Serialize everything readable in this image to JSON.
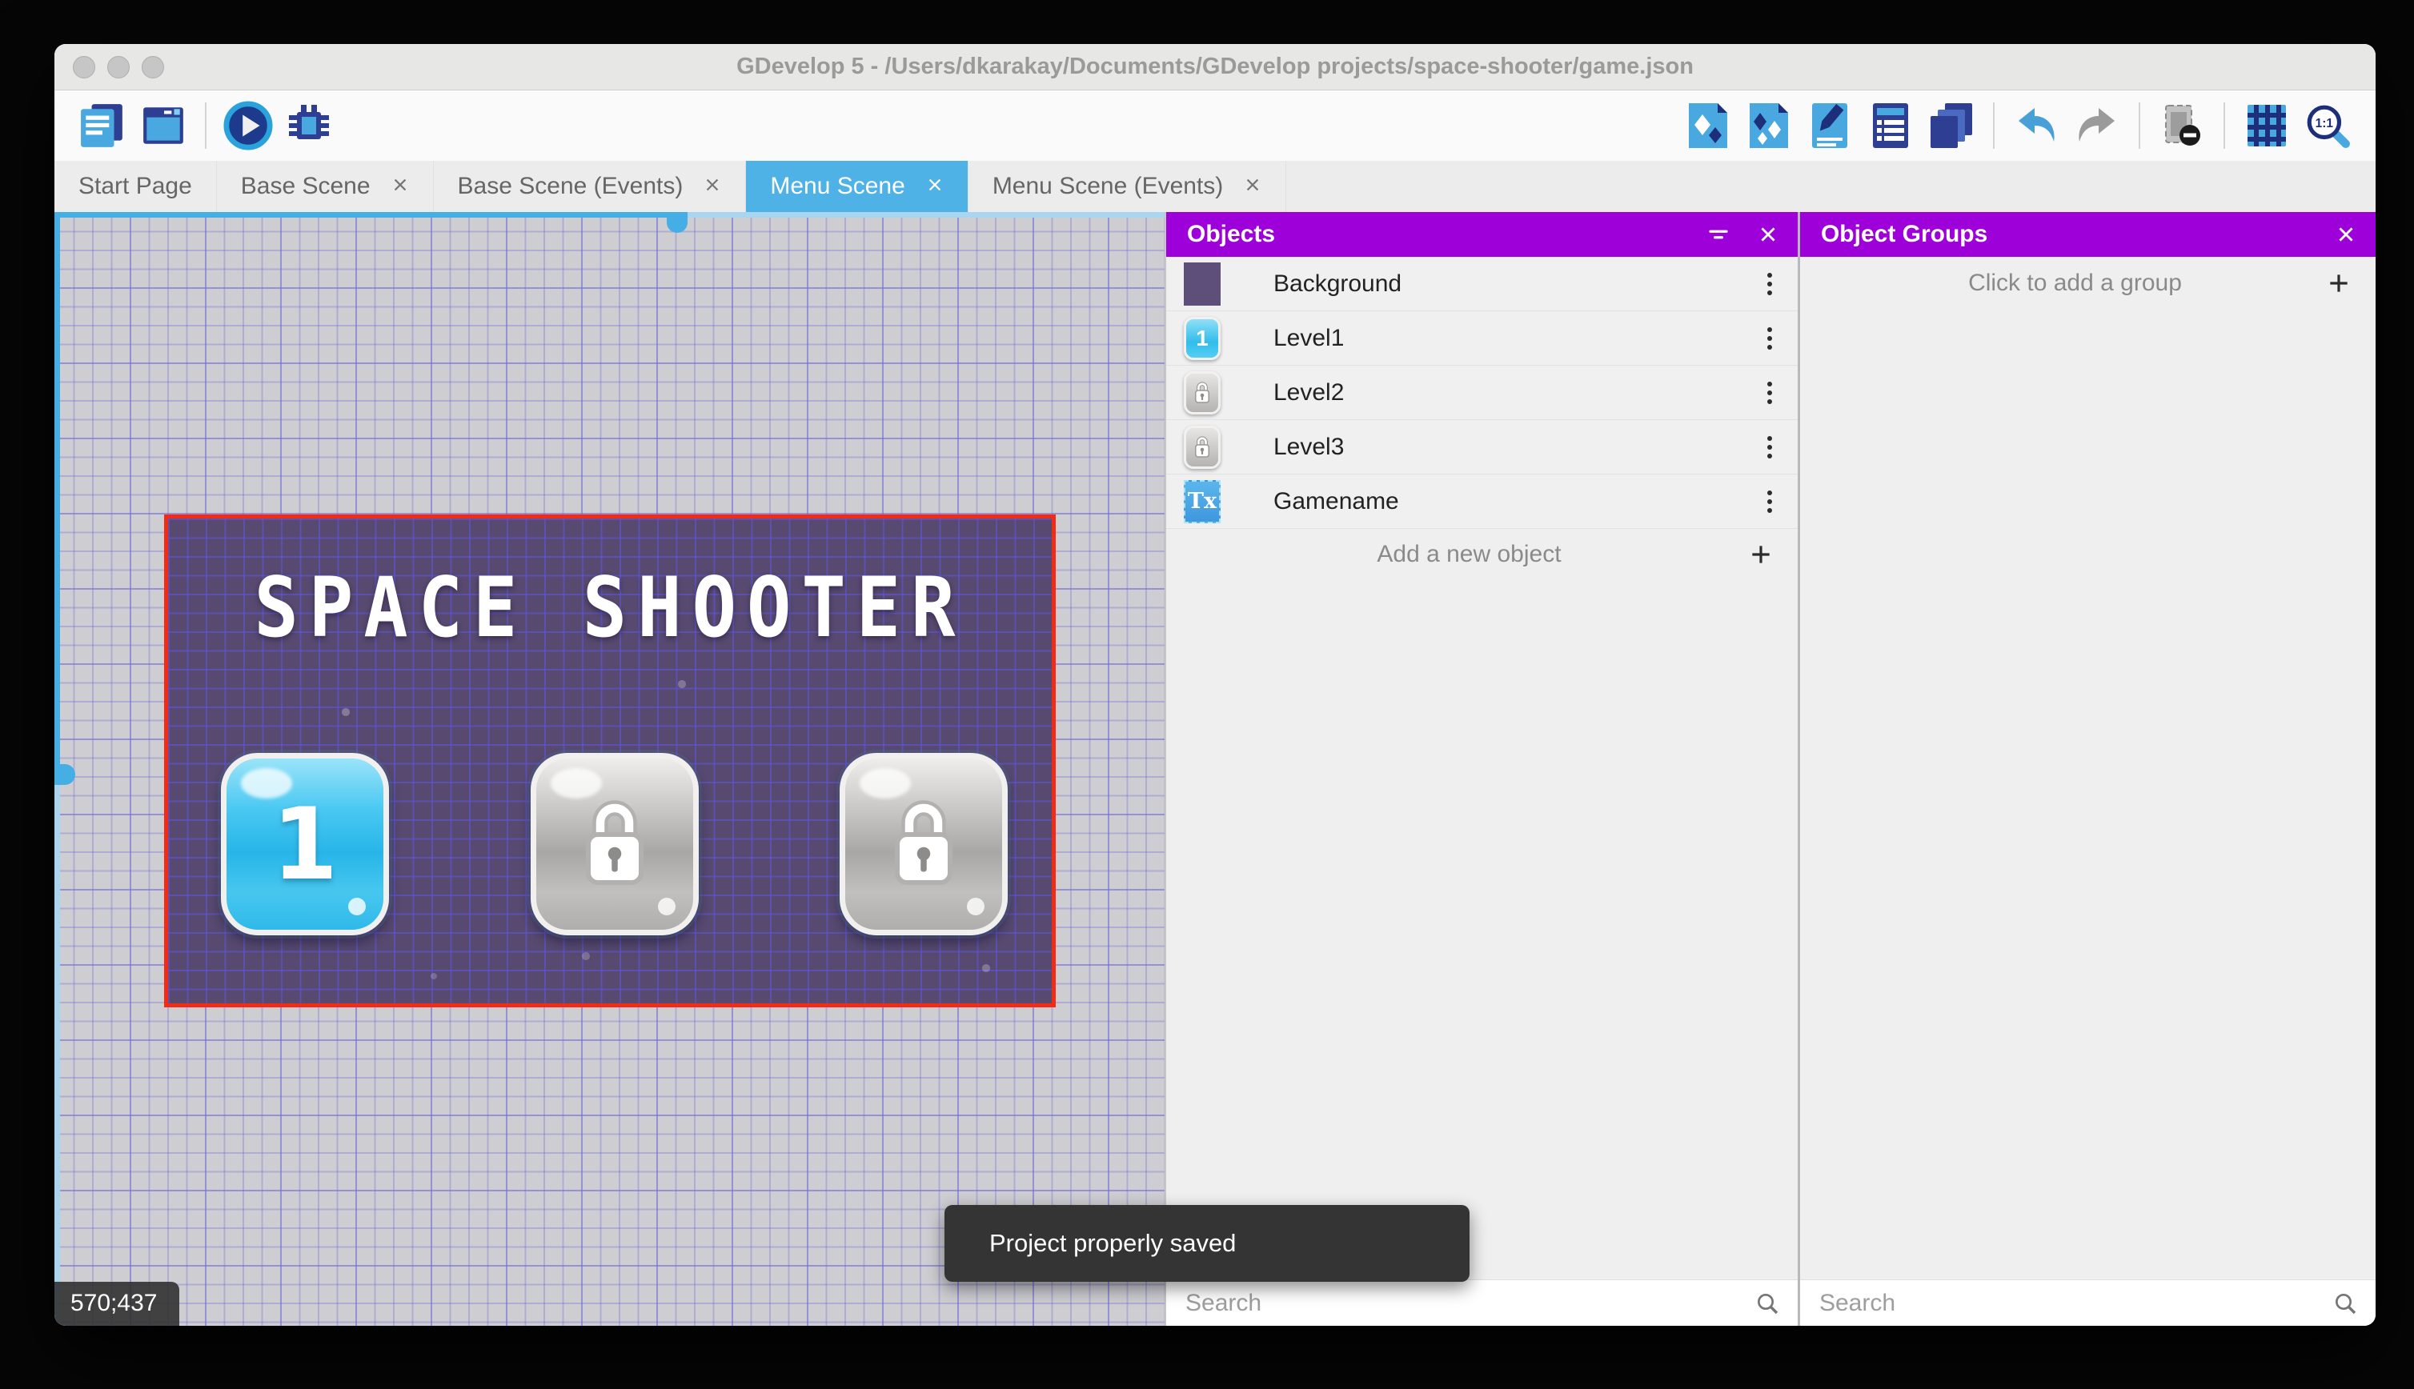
{
  "window": {
    "title": "GDevelop 5 - /Users/dkarakay/Documents/GDevelop projects/space-shooter/game.json"
  },
  "toolbar": {
    "left_icons": [
      "project-manager-icon",
      "scene-window-icon",
      "play-icon",
      "debug-icon"
    ],
    "right_icons": [
      "objects-editor-icon",
      "object-groups-icon",
      "properties-icon",
      "instances-list-icon",
      "layers-icon",
      "undo-icon",
      "redo-icon",
      "mask-toggle-icon",
      "grid-toggle-icon",
      "zoom-1-1-icon"
    ],
    "zoom_label": "1:1"
  },
  "tabs": [
    {
      "label": "Start Page",
      "closable": false,
      "active": false
    },
    {
      "label": "Base Scene",
      "closable": true,
      "active": false
    },
    {
      "label": "Base Scene (Events)",
      "closable": true,
      "active": false
    },
    {
      "label": "Menu Scene",
      "closable": true,
      "active": true
    },
    {
      "label": "Menu Scene (Events)",
      "closable": true,
      "active": false
    }
  ],
  "canvas": {
    "coordinates": "570;437",
    "scene": {
      "title": "SPACE SHOOTER",
      "buttons": [
        {
          "label": "1",
          "state": "unlocked"
        },
        {
          "label": "",
          "state": "locked"
        },
        {
          "label": "",
          "state": "locked"
        }
      ]
    }
  },
  "objects_panel": {
    "title": "Objects",
    "items": [
      {
        "name": "Background",
        "icon": "background-thumbnail",
        "icon_text": ""
      },
      {
        "name": "Level1",
        "icon": "level-button-thumbnail",
        "icon_text": "1"
      },
      {
        "name": "Level2",
        "icon": "locked-button-thumbnail",
        "icon_text": ""
      },
      {
        "name": "Level3",
        "icon": "locked-button-thumbnail",
        "icon_text": ""
      },
      {
        "name": "Gamename",
        "icon": "text-object-thumbnail",
        "icon_text": "Tx"
      }
    ],
    "add_label": "Add a new object",
    "search_placeholder": "Search"
  },
  "groups_panel": {
    "title": "Object Groups",
    "empty_label": "Click to add a group",
    "search_placeholder": "Search"
  },
  "toast": {
    "message": "Project properly saved"
  },
  "colors": {
    "panel_header_purple": "#9d00d8",
    "active_tab_blue": "#4fb2e6",
    "selection_red": "#f32a14",
    "scene_purple": "#57496f",
    "unlocked_button_cyan": "#2fb9e9",
    "toolbar_navy": "#2e3e92",
    "toolbar_blue": "#49a8e0"
  }
}
